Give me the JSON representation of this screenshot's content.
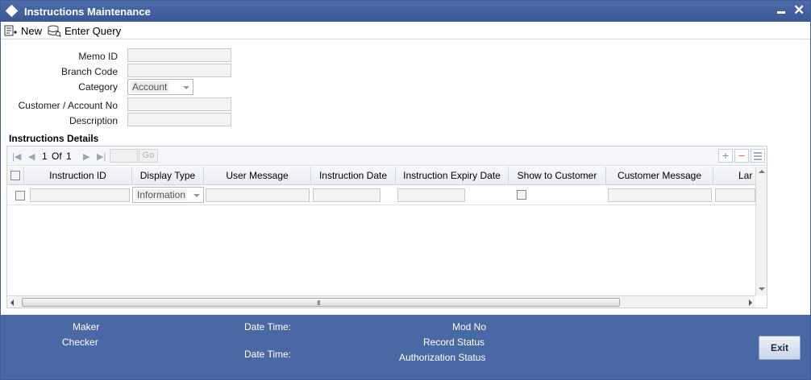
{
  "window": {
    "title": "Instructions Maintenance"
  },
  "toolbar": {
    "new_label": "New",
    "enter_query_label": "Enter Query"
  },
  "form": {
    "memo_id_label": "Memo ID",
    "branch_code_label": "Branch Code",
    "category_label": "Category",
    "category_value": "Account",
    "customer_account_label": "Customer / Account No",
    "description_label": "Description"
  },
  "details": {
    "title": "Instructions Details",
    "pager": {
      "current": "1",
      "of_label": "Of",
      "total": "1",
      "go_label": "Go"
    },
    "columns": [
      "Instruction ID",
      "Display Type",
      "User Message",
      "Instruction Date",
      "Instruction Expiry Date",
      "Show to Customer",
      "Customer Message",
      "Lar"
    ],
    "row": {
      "display_type": "Information"
    }
  },
  "footer": {
    "maker_label": "Maker",
    "checker_label": "Checker",
    "date_time_label_1": "Date Time:",
    "date_time_label_2": "Date Time:",
    "mod_no_label": "Mod No",
    "record_status_label": "Record Status",
    "authorization_status_label": "Authorization Status",
    "exit_label": "Exit"
  },
  "colors": {
    "titlebar": "#3f5d99",
    "footer": "#4a68a4",
    "accent": "#7d8fb5"
  }
}
